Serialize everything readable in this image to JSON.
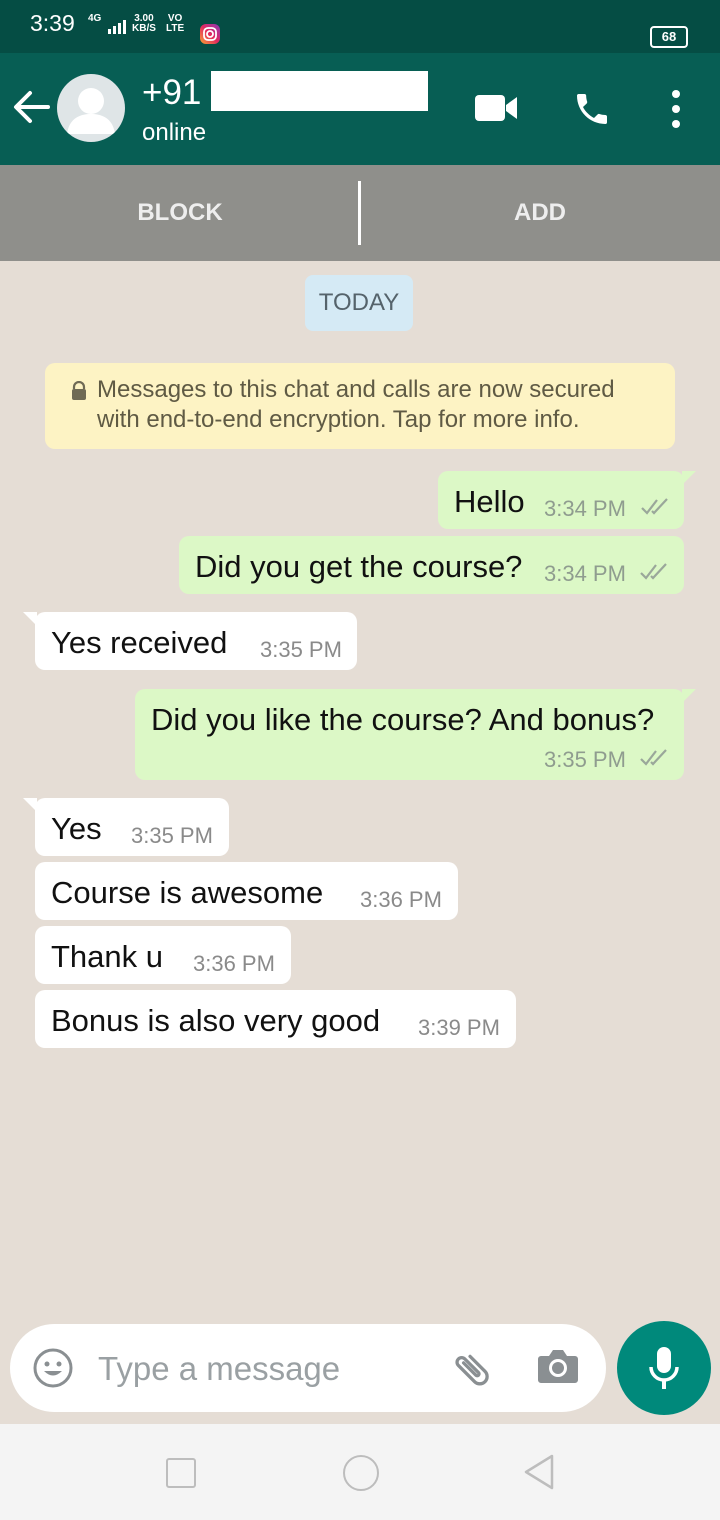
{
  "status_bar": {
    "time": "3:39",
    "network_top": "4G",
    "speed_top": "3.00",
    "speed_bottom": "KB/S",
    "volte_top": "VO",
    "volte_bottom": "LTE",
    "battery": "68"
  },
  "header": {
    "contact_name": "+91",
    "contact_status": "online",
    "icons": [
      "back-arrow-icon",
      "avatar",
      "video-call-icon",
      "voice-call-icon",
      "more-options-icon"
    ]
  },
  "actions": {
    "block_label": "BLOCK",
    "add_label": "ADD"
  },
  "chat": {
    "date_label": "TODAY",
    "encryption_notice_line1": "Messages to this chat and calls are now secured",
    "encryption_notice_line2": "with end-to-end encryption. Tap for more info.",
    "messages": [
      {
        "direction": "out",
        "text": "Hello",
        "time": "3:34 PM",
        "read": true
      },
      {
        "direction": "out",
        "text": "Did you get the course?",
        "time": "3:34 PM",
        "read": true
      },
      {
        "direction": "in",
        "text": "Yes received",
        "time": "3:35 PM"
      },
      {
        "direction": "out",
        "text": "Did you like the course? And bonus?",
        "time": "3:35 PM",
        "read": true
      },
      {
        "direction": "in",
        "text": "Yes",
        "time": "3:35 PM"
      },
      {
        "direction": "in",
        "text": "Course is awesome",
        "time": "3:36 PM"
      },
      {
        "direction": "in",
        "text": "Thank u",
        "time": "3:36 PM"
      },
      {
        "direction": "in",
        "text": "Bonus is also very good",
        "time": "3:39 PM"
      }
    ]
  },
  "composer": {
    "placeholder": "Type a message"
  },
  "colors": {
    "header": "#075e54",
    "status_bar": "#054d44",
    "outgoing_bubble": "#dcf8c6",
    "incoming_bubble": "#ffffff",
    "accent": "#00897b",
    "read_ticks": "#9aa79a"
  }
}
